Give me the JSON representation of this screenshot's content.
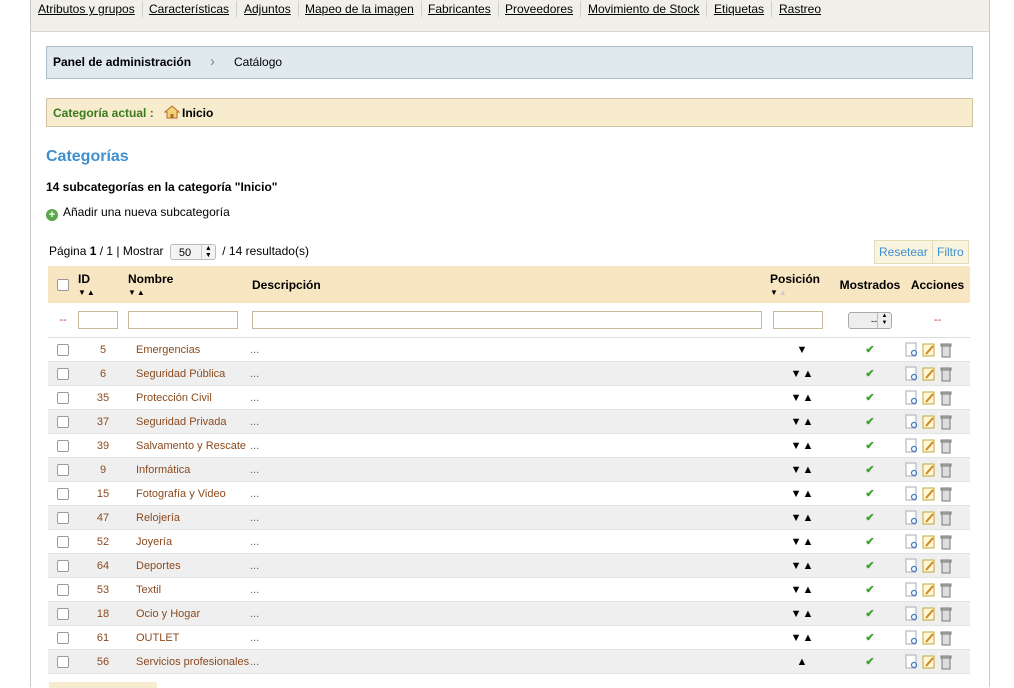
{
  "tabs": [
    "Atributos y grupos",
    "Características",
    "Adjuntos",
    "Mapeo de la imagen",
    "Fabricantes",
    "Proveedores",
    "Movimiento de Stock",
    "Etiquetas",
    "Rastreo"
  ],
  "breadcrumb": {
    "admin": "Panel de administración",
    "current": "Catálogo",
    "separator": "›"
  },
  "current_category": {
    "label": "Categoría actual :",
    "value": "Inicio",
    "icon": "home-icon"
  },
  "section_title": "Categorías",
  "subcount": "14 subcategorías en la categoría \"Inicio\"",
  "add_new": "Añadir una nueva subcategoría",
  "pager": {
    "page_label": "Página",
    "page": "1",
    "of": "/ 1 | Mostrar",
    "per_page": "50",
    "results": "/ 14 resultado(s)"
  },
  "buttons": {
    "reset": "Resetear",
    "filter": "Filtro"
  },
  "columns": {
    "id": "ID",
    "name": "Nombre",
    "description": "Descripción",
    "position": "Posición",
    "shown": "Mostrados",
    "actions": "Acciones"
  },
  "filter": {
    "dash": "--",
    "shown_select": "--"
  },
  "colors": {
    "link": "#8b4a1e",
    "header_bg": "#f8e6c3",
    "title": "#3e8fd0",
    "check": "#3aa52a"
  },
  "rows": [
    {
      "id": "5",
      "name": "Emergencias",
      "desc": "...",
      "pos": "down"
    },
    {
      "id": "6",
      "name": "Seguridad Pública",
      "desc": "...",
      "pos": "both"
    },
    {
      "id": "35",
      "name": "Protección Civil",
      "desc": "...",
      "pos": "both"
    },
    {
      "id": "37",
      "name": "Seguridad Privada",
      "desc": "...",
      "pos": "both"
    },
    {
      "id": "39",
      "name": "Salvamento y Rescate",
      "desc": "...",
      "pos": "both"
    },
    {
      "id": "9",
      "name": "Informática",
      "desc": "...",
      "pos": "both"
    },
    {
      "id": "15",
      "name": "Fotografía y Video",
      "desc": "...",
      "pos": "both"
    },
    {
      "id": "47",
      "name": "Relojería",
      "desc": "...",
      "pos": "both"
    },
    {
      "id": "52",
      "name": "Joyería",
      "desc": "...",
      "pos": "both"
    },
    {
      "id": "64",
      "name": "Deportes",
      "desc": "...",
      "pos": "both"
    },
    {
      "id": "53",
      "name": "Textil",
      "desc": "...",
      "pos": "both"
    },
    {
      "id": "18",
      "name": "Ocio y Hogar",
      "desc": "...",
      "pos": "both"
    },
    {
      "id": "61",
      "name": "OUTLET",
      "desc": "...",
      "pos": "both"
    },
    {
      "id": "56",
      "name": "Servicios profesionales",
      "desc": "...",
      "pos": "up"
    }
  ]
}
